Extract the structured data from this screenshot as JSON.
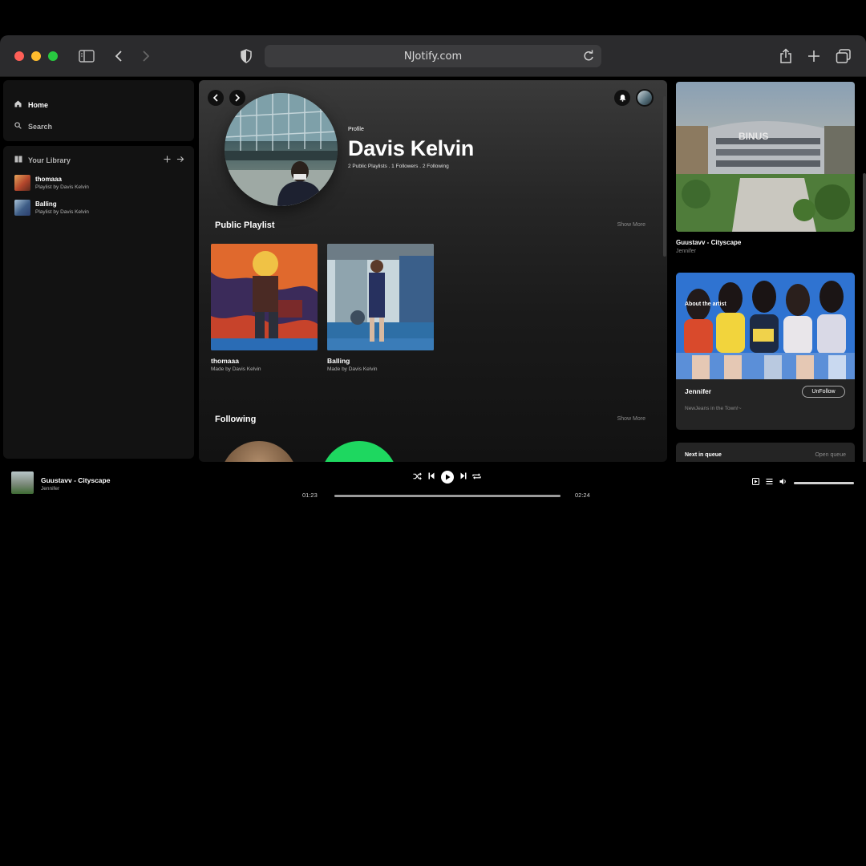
{
  "browser": {
    "url": "NJotify.com"
  },
  "sidebar": {
    "nav": [
      {
        "label": "Home",
        "icon": "home-icon"
      },
      {
        "label": "Search",
        "icon": "search-icon"
      }
    ],
    "library_title": "Your Library",
    "library_items": [
      {
        "title": "thomaaa",
        "subtitle": "Playlist by Davis Kelvin"
      },
      {
        "title": "Balling",
        "subtitle": "Playlist by Davis Kelvin"
      }
    ]
  },
  "profile": {
    "label": "Profile",
    "name": "Davis Kelvin",
    "stats": "2 Public Playlists . 1 Followers . 2 Following"
  },
  "public_playlist": {
    "title": "Public Playlist",
    "show_more": "Show More",
    "items": [
      {
        "title": "thomaaa",
        "subtitle": "Made by Davis Kelvin"
      },
      {
        "title": "Balling",
        "subtitle": "Made by Davis Kelvin"
      }
    ]
  },
  "following": {
    "title": "Following",
    "show_more": "Show More"
  },
  "now_playing": {
    "title": "Guustavv - Cityscape",
    "artist": "Jennifer",
    "about_label": "About the artist",
    "artist_name": "Jennifer",
    "unfollow_label": "UnFollow",
    "artist_description": "NewJeans in the Town!~",
    "queue_title": "Next in queue",
    "queue_open": "Open queue"
  },
  "player": {
    "title": "Guustavv - Cityscape",
    "artist": "Jennifer",
    "elapsed": "01:23",
    "duration": "02:24",
    "progress_fraction": 1.0,
    "volume_fraction": 1.0
  },
  "colors": {
    "accent_green": "#1ed760",
    "background": "#121212"
  }
}
